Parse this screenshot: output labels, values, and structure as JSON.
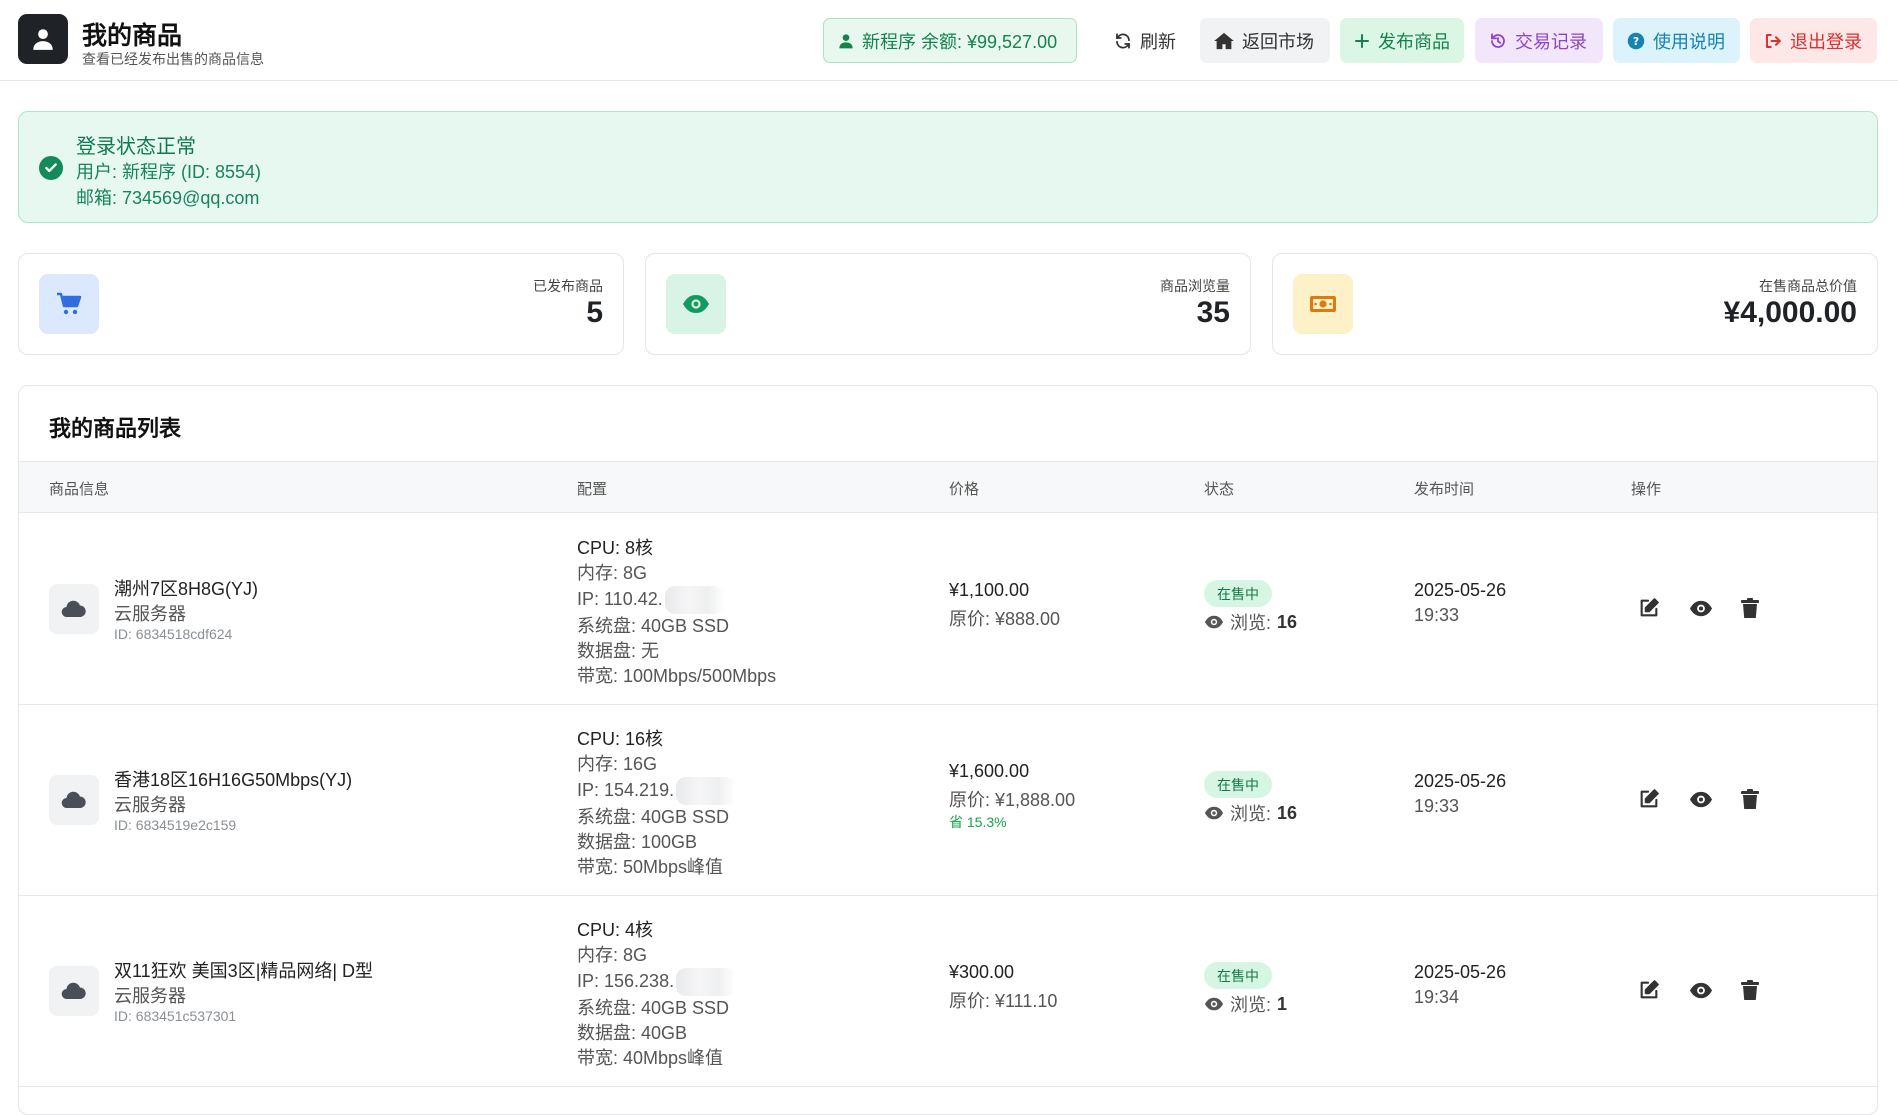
{
  "header": {
    "title": "我的商品",
    "subtitle": "查看已经发布出售的商品信息",
    "balance_label": "新程序  余额: ¥99,527.00",
    "refresh_label": "刷新",
    "market_label": "返回市场",
    "publish_label": "发布商品",
    "trades_label": "交易记录",
    "guide_label": "使用说明",
    "logout_label": "退出登录"
  },
  "login_status": {
    "title": "登录状态正常",
    "user": "用户: 新程序 (ID: 8554)",
    "email": "邮箱: 734569@qq.com"
  },
  "stats": {
    "published": {
      "label": "已发布商品",
      "value": "5"
    },
    "views": {
      "label": "商品浏览量",
      "value": "35"
    },
    "total_value": {
      "label": "在售商品总价值",
      "value": "¥4,000.00"
    }
  },
  "list": {
    "title": "我的商品列表",
    "columns": [
      "商品信息",
      "配置",
      "价格",
      "状态",
      "发布时间",
      "操作"
    ],
    "rows": [
      {
        "name": "潮州7区8H8G(YJ)",
        "type": "云服务器",
        "id": "ID: 6834518cdf624",
        "cpu": "CPU: 8核",
        "mem": "内存: 8G",
        "ip": "IP: 110.42.",
        "sys_disk": "系统盘: 40GB SSD",
        "data_disk": "数据盘: 无",
        "bandwidth": "带宽: 100Mbps/500Mbps",
        "price": "¥1,100.00",
        "original": "原价: ¥888.00",
        "saving": "",
        "status": "在售中",
        "views_label": "浏览:",
        "views": "16",
        "date": "2025-05-26",
        "time": "19:33"
      },
      {
        "name": "香港18区16H16G50Mbps(YJ)",
        "type": "云服务器",
        "id": "ID: 6834519e2c159",
        "cpu": "CPU: 16核",
        "mem": "内存: 16G",
        "ip": "IP: 154.219.",
        "sys_disk": "系统盘: 40GB SSD",
        "data_disk": "数据盘: 100GB",
        "bandwidth": "带宽: 50Mbps峰值",
        "price": "¥1,600.00",
        "original": "原价: ¥1,888.00",
        "saving": "省 15.3%",
        "status": "在售中",
        "views_label": "浏览:",
        "views": "16",
        "date": "2025-05-26",
        "time": "19:33"
      },
      {
        "name": "双11狂欢 美国3区|精品网络| D型",
        "type": "云服务器",
        "id": "ID: 683451c537301",
        "cpu": "CPU: 4核",
        "mem": "内存: 8G",
        "ip": "IP: 156.238.",
        "sys_disk": "系统盘: 40GB SSD",
        "data_disk": "数据盘: 40GB",
        "bandwidth": "带宽: 40Mbps峰值",
        "price": "¥300.00",
        "original": "原价: ¥111.10",
        "saving": "",
        "status": "在售中",
        "views_label": "浏览:",
        "views": "1",
        "date": "2025-05-26",
        "time": "19:34"
      }
    ]
  },
  "colors": {
    "accent_green": "#13834b",
    "danger": "#dc2f2f",
    "purple": "#8e44c7",
    "info": "#1784b0"
  }
}
